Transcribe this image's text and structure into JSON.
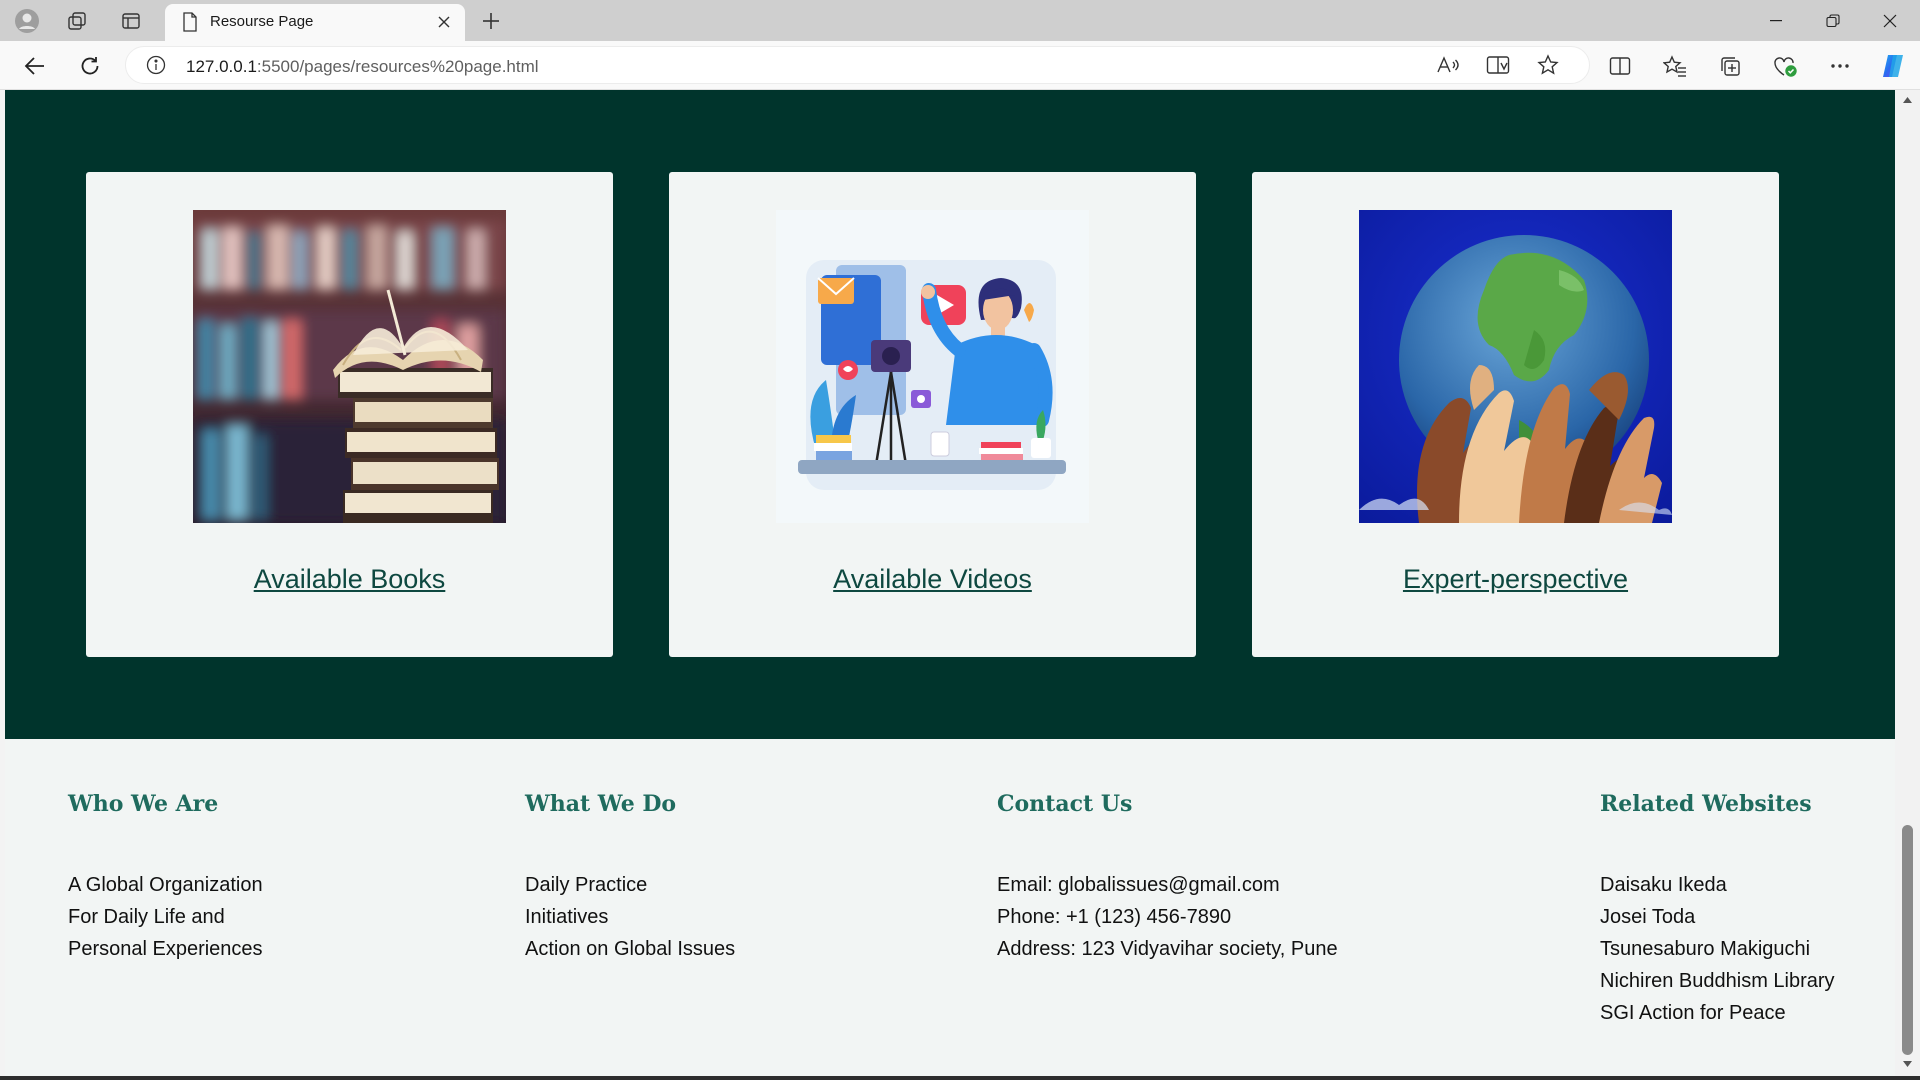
{
  "browser": {
    "tab_title": "Resourse Page",
    "url_host": "127.0.0.1",
    "url_path": ":5500/pages/resources%20page.html",
    "icons": [
      "profile-icon",
      "workspaces-icon",
      "tab-actions-icon",
      "page-icon",
      "close-icon",
      "new-tab-icon",
      "minimize-icon",
      "restore-icon",
      "window-close-icon",
      "back-icon",
      "refresh-icon",
      "info-icon",
      "read-aloud-icon",
      "immersive-reader-icon",
      "favorite-star-icon",
      "split-screen-icon",
      "favorites-icon",
      "collections-icon",
      "browser-essentials-icon",
      "more-icon",
      "copilot-icon"
    ]
  },
  "resources": {
    "cards": [
      {
        "label": "Available Books",
        "image": "books-photo"
      },
      {
        "label": "Available Videos",
        "image": "video-creator-illustration"
      },
      {
        "label": "Expert-perspective",
        "image": "hands-holding-globe-photo"
      }
    ]
  },
  "footer": {
    "who": {
      "title": "Who We Are",
      "items": [
        "A Global Organization",
        "For Daily Life and",
        "Personal Experiences"
      ]
    },
    "what": {
      "title": "What We Do",
      "items": [
        "Daily Practice",
        "Initiatives",
        "Action on Global Issues"
      ]
    },
    "contact": {
      "title": "Contact Us",
      "items": [
        "Email: globalissues@gmail.com",
        "Phone: +1 (123) 456-7890",
        "Address: 123 Vidyavihar society, Pune"
      ]
    },
    "related": {
      "title": "Related Websites",
      "items": [
        "Daisaku Ikeda",
        "Josei Toda",
        "Tsunesaburo Makiguchi",
        "Nichiren Buddhism Library",
        "SGI Action for Peace"
      ]
    }
  },
  "colors": {
    "hero_bg": "#00342c",
    "page_bg": "#f2f5f4",
    "link": "#0e4840",
    "footer_heading": "#1f6b5e"
  }
}
